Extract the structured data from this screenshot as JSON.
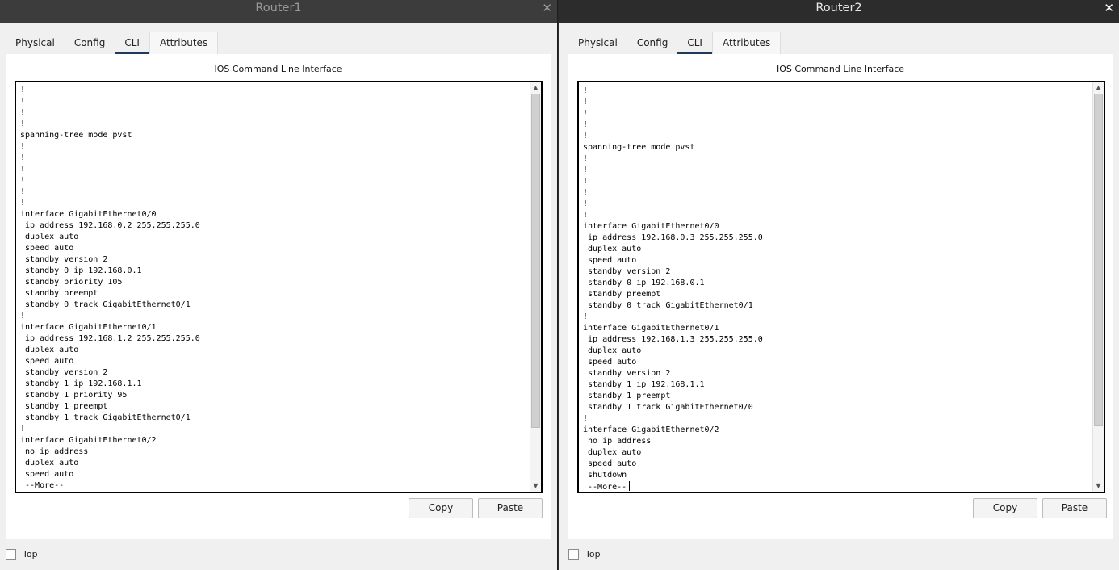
{
  "windows": [
    {
      "title": "Router1",
      "close_glyph": "✕",
      "tabs": [
        "Physical",
        "Config",
        "CLI",
        "Attributes"
      ],
      "active_tab": "CLI",
      "cli_heading": "IOS Command Line Interface",
      "terminal_lines": [
        "!",
        "!",
        "!",
        "!",
        "spanning-tree mode pvst",
        "!",
        "!",
        "!",
        "!",
        "!",
        "!",
        "interface GigabitEthernet0/0",
        " ip address 192.168.0.2 255.255.255.0",
        " duplex auto",
        " speed auto",
        " standby version 2",
        " standby 0 ip 192.168.0.1",
        " standby priority 105",
        " standby preempt",
        " standby 0 track GigabitEthernet0/1",
        "!",
        "interface GigabitEthernet0/1",
        " ip address 192.168.1.2 255.255.255.0",
        " duplex auto",
        " speed auto",
        " standby version 2",
        " standby 1 ip 192.168.1.1",
        " standby 1 priority 95",
        " standby 1 preempt",
        " standby 1 track GigabitEthernet0/1",
        "!",
        "interface GigabitEthernet0/2",
        " no ip address",
        " duplex auto",
        " speed auto",
        " --More--"
      ],
      "copy_label": "Copy",
      "paste_label": "Paste",
      "top_label": "Top",
      "top_checked": false
    },
    {
      "title": "Router2",
      "close_glyph": "✕",
      "tabs": [
        "Physical",
        "Config",
        "CLI",
        "Attributes"
      ],
      "active_tab": "CLI",
      "cli_heading": "IOS Command Line Interface",
      "terminal_lines": [
        "!",
        "!",
        "!",
        "!",
        "!",
        "spanning-tree mode pvst",
        "!",
        "!",
        "!",
        "!",
        "!",
        "!",
        "interface GigabitEthernet0/0",
        " ip address 192.168.0.3 255.255.255.0",
        " duplex auto",
        " speed auto",
        " standby version 2",
        " standby 0 ip 192.168.0.1",
        " standby preempt",
        " standby 0 track GigabitEthernet0/1",
        "!",
        "interface GigabitEthernet0/1",
        " ip address 192.168.1.3 255.255.255.0",
        " duplex auto",
        " speed auto",
        " standby version 2",
        " standby 1 ip 192.168.1.1",
        " standby 1 preempt",
        " standby 1 track GigabitEthernet0/0",
        "!",
        "interface GigabitEthernet0/2",
        " no ip address",
        " duplex auto",
        " speed auto",
        " shutdown",
        " --More--"
      ],
      "copy_label": "Copy",
      "paste_label": "Paste",
      "top_label": "Top",
      "top_checked": false
    }
  ],
  "colors": {
    "active_tab_underline": "#1f3a5a",
    "titlebar_inactive": "#3c3c3c",
    "titlebar_active": "#2c2c2c"
  },
  "icons": {
    "close": "close-icon",
    "scroll_up": "scroll-up-arrow-icon",
    "scroll_down": "scroll-down-arrow-icon"
  }
}
